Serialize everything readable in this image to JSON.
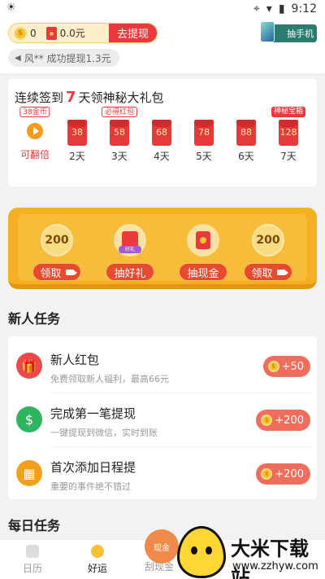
{
  "status_bar": {
    "time": "9:12"
  },
  "header": {
    "coin_balance": "0",
    "cash_balance": "0.0元",
    "withdraw_label": "去提现",
    "lottery_label": "抽手机",
    "notice": "风** 成功提现1.3元"
  },
  "checkin": {
    "title_prefix": "连续签到",
    "title_days": "7",
    "title_suffix": "天领神秘大礼包",
    "first_tag": "38金币",
    "first_label": "可翻倍",
    "days": [
      {
        "amount": "38",
        "label": "2天",
        "tag": ""
      },
      {
        "amount": "58",
        "label": "3天",
        "tag": "必得红包"
      },
      {
        "amount": "68",
        "label": "4天",
        "tag": ""
      },
      {
        "amount": "78",
        "label": "5天",
        "tag": ""
      },
      {
        "amount": "88",
        "label": "6天",
        "tag": ""
      },
      {
        "amount": "128",
        "label": "7天",
        "tag": "神秘宝箱"
      }
    ]
  },
  "rewards": [
    {
      "value": "200",
      "button": "领取",
      "icon": "coin-medal-icon"
    },
    {
      "value": "",
      "button": "抽好礼",
      "icon": "gift-box-icon"
    },
    {
      "value": "",
      "button": "抽现金",
      "icon": "red-envelope-icon"
    },
    {
      "value": "200",
      "button": "领取",
      "icon": "coin-medal-icon"
    }
  ],
  "newbie_tasks": {
    "heading": "新人任务",
    "items": [
      {
        "title": "新人红包",
        "subtitle": "免费领取新人福利，最高66元",
        "reward": "+50",
        "icon": "gift-icon",
        "color": "#ec4a4a"
      },
      {
        "title": "完成第一笔提现",
        "subtitle": "一键提现到微信，实时到账",
        "reward": "+200",
        "icon": "money-bag-icon",
        "color": "#2fb560"
      },
      {
        "title": "首次添加日程提",
        "subtitle": "重要的事件绝不错过",
        "reward": "+200",
        "icon": "calendar-icon",
        "color": "#f2a01b"
      }
    ]
  },
  "daily_tasks": {
    "heading": "每日任务"
  },
  "bottom_nav": [
    {
      "label": "日历",
      "active": false
    },
    {
      "label": "好运",
      "active": true
    },
    {
      "label": "刮现金",
      "active": false
    }
  ],
  "float_ad": {
    "label": "现金"
  },
  "watermark": {
    "name": "大米下载站",
    "url": "www.zzhyw.com"
  }
}
